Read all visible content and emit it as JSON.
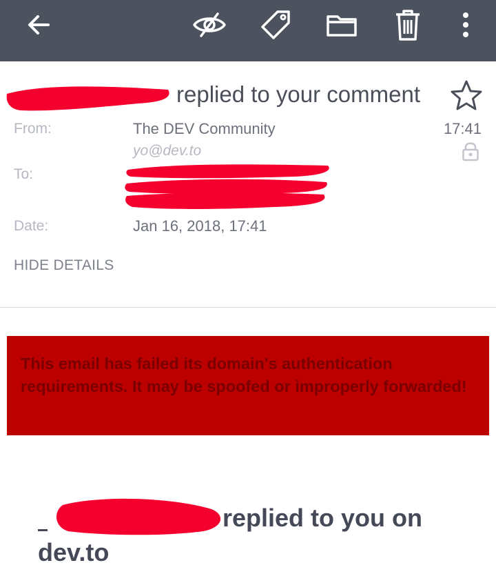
{
  "toolbar": {
    "back_icon": "arrow-left-icon",
    "actions": [
      "eye-off-icon",
      "tag-icon",
      "folder-icon",
      "trash-icon",
      "more-vertical-icon"
    ],
    "background": "#4d525f"
  },
  "message": {
    "subject_suffix": "replied to your comment",
    "star_icon": "star-outline-icon",
    "from_label": "From:",
    "from_name": "The DEV Community",
    "from_email": "yo@dev.to",
    "time": "17:41",
    "to_label": "To:",
    "date_label": "Date:",
    "date_value": "Jan 16, 2018, 17:41",
    "hide_details": "HIDE DETAILS",
    "lock_icon": "lock-icon"
  },
  "warning": {
    "text": "This email has failed its domain's authentication requirements. It may be spoofed or improperly forwarded!",
    "background": "#bc0000",
    "text_color": "#7a0000"
  },
  "body": {
    "headline_line1": "replied to you on",
    "headline_line2": "dev.to"
  },
  "redaction_color": "#f5002e"
}
